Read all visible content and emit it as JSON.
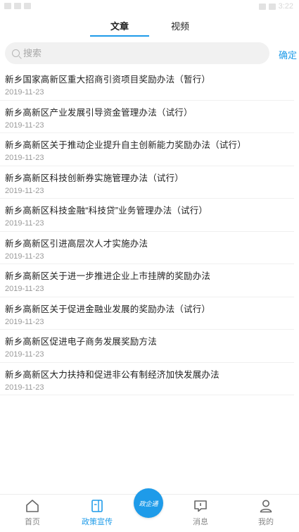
{
  "status_bar": {
    "time": "3:22"
  },
  "tabs": [
    {
      "label": "文章",
      "active": true
    },
    {
      "label": "视频",
      "active": false
    }
  ],
  "search": {
    "placeholder": "搜索",
    "value": "",
    "confirm_label": "确定"
  },
  "articles": [
    {
      "title": "新乡国家高新区重大招商引资项目奖励办法（暂行）",
      "date": "2019-11-23"
    },
    {
      "title": "新乡高新区产业发展引导资金管理办法（试行）",
      "date": "2019-11-23"
    },
    {
      "title": "新乡高新区关于推动企业提升自主创新能力奖励办法（试行）",
      "date": "2019-11-23"
    },
    {
      "title": "新乡高新区科技创新券实施管理办法（试行）",
      "date": "2019-11-23"
    },
    {
      "title": "新乡高新区科技金融“科技贷”业务管理办法（试行）",
      "date": "2019-11-23"
    },
    {
      "title": "新乡高新区引进高层次人才实施办法",
      "date": "2019-11-23"
    },
    {
      "title": "新乡高新区关于进一步推进企业上市挂牌的奖励办法",
      "date": "2019-11-23"
    },
    {
      "title": "新乡高新区关于促进金融业发展的奖励办法（试行）",
      "date": "2019-11-23"
    },
    {
      "title": "新乡高新区促进电子商务发展奖励方法",
      "date": "2019-11-23"
    },
    {
      "title": "新乡高新区大力扶持和促进非公有制经济加快发展办法",
      "date": "2019-11-23"
    }
  ],
  "bottom_nav": {
    "home": {
      "label": "首页",
      "icon": "home-icon"
    },
    "policy": {
      "label": "政策宣传",
      "icon": "document-icon",
      "active": true
    },
    "center": {
      "label": "政企通",
      "icon": "logo-icon"
    },
    "messages": {
      "label": "消息",
      "icon": "message-icon"
    },
    "mine": {
      "label": "我的",
      "icon": "user-icon"
    }
  },
  "colors": {
    "accent": "#1e9be9",
    "text": "#222222",
    "muted": "#9a9a9a"
  }
}
